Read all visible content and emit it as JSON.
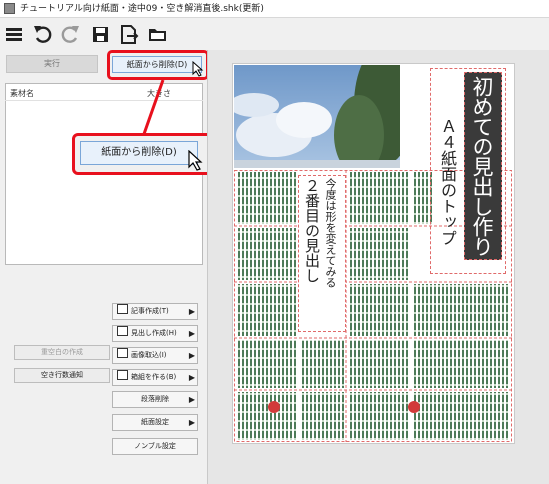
{
  "window": {
    "title": "チュートリアル向け紙面・途中09・空き解消直後.shk(更新)"
  },
  "toolbar": {
    "icons": [
      "menu-icon",
      "undo-icon",
      "redo-icon",
      "save-icon",
      "export-icon",
      "open-folder-icon"
    ]
  },
  "left_panel": {
    "execute_label": "実行",
    "delete_from_page_label": "紙面から削除(D)",
    "columns": {
      "name": "素材名",
      "size": "大きさ"
    },
    "callout_label": "紙面から削除(D)",
    "reset_space_label": "重空白の作成",
    "blank_line_count_label": "空き行数通知"
  },
  "actions": {
    "article_create": "記事作成(T)",
    "headline_create": "見出し作成(H)",
    "image_import": "画像取込(I)",
    "box_create": "箱組を作る(B)",
    "paragraph_delete": "段落削除",
    "page_settings": "紙面設定",
    "nombre_settings": "ノンブル設定",
    "submenu_arrow": "▶"
  },
  "page": {
    "headline": "初めての見出し作り",
    "subheadline": "Ａ４紙面のトップ",
    "second_headline_small": "今度は形を変えてみる",
    "second_headline_large": "２番目の見出し"
  },
  "colors": {
    "highlight": "#e8101d",
    "accent": "#2b6cc4",
    "text_green": "#3b6e4a",
    "selection": "#e06a6a"
  }
}
